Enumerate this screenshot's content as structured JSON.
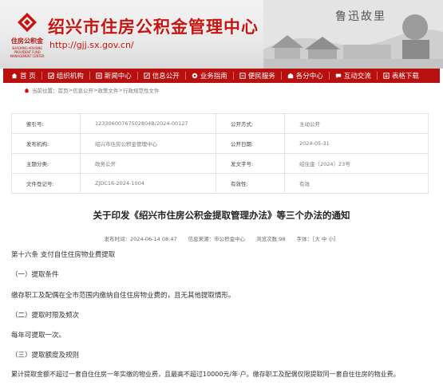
{
  "header": {
    "logo_cn": "住房公积金",
    "logo_en": "SHAOXING HOUSING PROVIDENT FUND MANAGEMENT CENTER",
    "site_title": "绍兴市住房公积金管理中心",
    "site_url": "http://gjj.sx.gov.cn/",
    "calligraphy": "鲁迅故里"
  },
  "nav": {
    "items": [
      {
        "label": "首 页",
        "icon": "home-icon"
      },
      {
        "label": "组织机构",
        "icon": "org-icon"
      },
      {
        "label": "新闻中心",
        "icon": "news-icon"
      },
      {
        "label": "信息公开",
        "icon": "info-icon"
      },
      {
        "label": "业务指南",
        "icon": "guide-icon"
      },
      {
        "label": "便民服务",
        "icon": "service-icon"
      },
      {
        "label": "各分中心",
        "icon": "branch-icon"
      },
      {
        "label": "互动交流",
        "icon": "chat-icon"
      },
      {
        "label": "表格下载",
        "icon": "download-icon"
      }
    ]
  },
  "breadcrumb": {
    "prefix": "当前位置：",
    "items": [
      "首页",
      "信息公开",
      "政策文件",
      "行政规范性文件"
    ],
    "separator": " > "
  },
  "meta": {
    "index_no_label": "索引号:",
    "index_no": "12330600767502804B/2024-00127",
    "public_method_label": "公开方式:",
    "public_method": "主动公开",
    "issuer_label": "发布机构:",
    "issuer": "绍兴市住房公积金管理中心",
    "public_date_label": "公开日期:",
    "public_date": "2024-05-31",
    "topic_label": "主题分类:",
    "topic": "政务公开",
    "doc_no_label": "发文字号:",
    "doc_no": "绍住金〔2024〕23号",
    "register_label": "文件登记号:",
    "register_no": "ZJDC16-2024-1004",
    "validity_label": "有效性:",
    "validity": "有效"
  },
  "article": {
    "title": "关于印发《绍兴市住房公积金提取管理办法》等三个办法的通知",
    "publish_time": "发布时间：2024-06-14 08:47",
    "source": "信息来源：市公积金中心",
    "views": "浏览次数:98",
    "font_size": "字体：［大 中 小］",
    "paragraphs": [
      "第十六条 支付自住住房物业费提取",
      "（一）提取条件",
      "缴存职工及配偶在全市范围内缴纳自住住房物业费的，且无其他提取情形。",
      "（二）提取时限及频次",
      "每年可提取一次。",
      "（三）提取额度及规则",
      "累计提取金额不超过一套自住住房一年实缴的物业费，且最高不超过10000元/年·户。缴存职工及配偶仅限提取同一套自住住房的物业费。"
    ]
  },
  "colors": {
    "nav_bg": "#b80f0f",
    "title_red": "#c8130f"
  }
}
